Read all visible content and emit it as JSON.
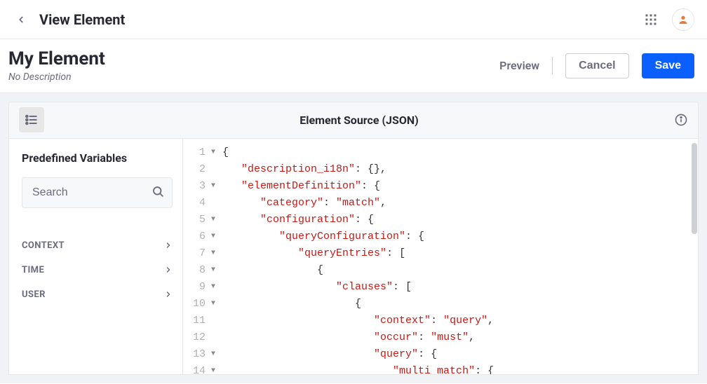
{
  "topbar": {
    "title": "View Element"
  },
  "header": {
    "title": "My Element",
    "subtitle": "No Description",
    "preview_label": "Preview",
    "cancel_label": "Cancel",
    "save_label": "Save"
  },
  "panel": {
    "title": "Element Source (JSON)"
  },
  "sidebar": {
    "title": "Predefined Variables",
    "search_placeholder": "Search",
    "vars": [
      "CONTEXT",
      "TIME",
      "USER"
    ]
  },
  "editor": {
    "lines": [
      {
        "n": 1,
        "fold": true,
        "indent": 0,
        "tokens": [
          {
            "t": "{",
            "c": "punc"
          }
        ]
      },
      {
        "n": 2,
        "fold": false,
        "indent": 1,
        "tokens": [
          {
            "t": "\"description_i18n\"",
            "c": "key"
          },
          {
            "t": ": {},",
            "c": "punc"
          }
        ]
      },
      {
        "n": 3,
        "fold": true,
        "indent": 1,
        "tokens": [
          {
            "t": "\"elementDefinition\"",
            "c": "key"
          },
          {
            "t": ": {",
            "c": "punc"
          }
        ]
      },
      {
        "n": 4,
        "fold": false,
        "indent": 2,
        "tokens": [
          {
            "t": "\"category\"",
            "c": "key"
          },
          {
            "t": ": ",
            "c": "punc"
          },
          {
            "t": "\"match\"",
            "c": "str"
          },
          {
            "t": ",",
            "c": "punc"
          }
        ]
      },
      {
        "n": 5,
        "fold": true,
        "indent": 2,
        "tokens": [
          {
            "t": "\"configuration\"",
            "c": "key"
          },
          {
            "t": ": {",
            "c": "punc"
          }
        ]
      },
      {
        "n": 6,
        "fold": true,
        "indent": 3,
        "tokens": [
          {
            "t": "\"queryConfiguration\"",
            "c": "key"
          },
          {
            "t": ": {",
            "c": "punc"
          }
        ]
      },
      {
        "n": 7,
        "fold": true,
        "indent": 4,
        "tokens": [
          {
            "t": "\"queryEntries\"",
            "c": "key"
          },
          {
            "t": ": [",
            "c": "punc"
          }
        ]
      },
      {
        "n": 8,
        "fold": true,
        "indent": 5,
        "tokens": [
          {
            "t": "{",
            "c": "punc"
          }
        ]
      },
      {
        "n": 9,
        "fold": true,
        "indent": 6,
        "tokens": [
          {
            "t": "\"clauses\"",
            "c": "key"
          },
          {
            "t": ": [",
            "c": "punc"
          }
        ]
      },
      {
        "n": 10,
        "fold": true,
        "indent": 7,
        "tokens": [
          {
            "t": "{",
            "c": "punc"
          }
        ]
      },
      {
        "n": 11,
        "fold": false,
        "indent": 8,
        "tokens": [
          {
            "t": "\"context\"",
            "c": "key"
          },
          {
            "t": ": ",
            "c": "punc"
          },
          {
            "t": "\"query\"",
            "c": "str"
          },
          {
            "t": ",",
            "c": "punc"
          }
        ]
      },
      {
        "n": 12,
        "fold": false,
        "indent": 8,
        "tokens": [
          {
            "t": "\"occur\"",
            "c": "key"
          },
          {
            "t": ": ",
            "c": "punc"
          },
          {
            "t": "\"must\"",
            "c": "str"
          },
          {
            "t": ",",
            "c": "punc"
          }
        ]
      },
      {
        "n": 13,
        "fold": true,
        "indent": 8,
        "tokens": [
          {
            "t": "\"query\"",
            "c": "key"
          },
          {
            "t": ": {",
            "c": "punc"
          }
        ]
      },
      {
        "n": 14,
        "fold": true,
        "indent": 9,
        "tokens": [
          {
            "t": "\"multi_match\"",
            "c": "key"
          },
          {
            "t": ": {",
            "c": "punc"
          }
        ]
      }
    ]
  }
}
